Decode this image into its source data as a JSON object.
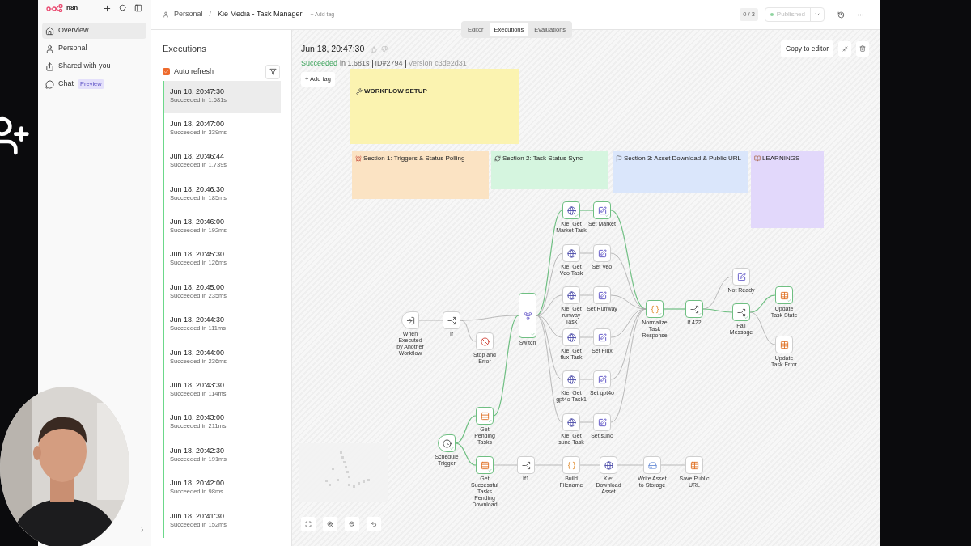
{
  "app": {
    "logo": "n8n"
  },
  "sidebar": {
    "items": [
      {
        "label": "Overview",
        "selected": true
      },
      {
        "label": "Personal",
        "selected": false
      },
      {
        "label": "Shared with you",
        "selected": false
      },
      {
        "label": "Chat",
        "badge": "Preview",
        "selected": false
      }
    ]
  },
  "breadcrumb": {
    "project": "Personal",
    "separator": "/",
    "workflow": "Kie Media - Task Manager",
    "add_tag": "+ Add tag"
  },
  "view_tabs": [
    {
      "label": "Editor",
      "selected": false
    },
    {
      "label": "Executions",
      "selected": true
    },
    {
      "label": "Evaluations",
      "selected": false
    }
  ],
  "header_right": {
    "counter": "0 / 3",
    "publish_status": "Published"
  },
  "executions": {
    "title": "Executions",
    "auto_refresh": {
      "label": "Auto refresh",
      "checked": true
    },
    "items": [
      {
        "time": "Jun 18, 20:47:30",
        "status": "Succeeded in 1.681s",
        "selected": true
      },
      {
        "time": "Jun 18, 20:47:00",
        "status": "Succeeded in 339ms",
        "selected": false
      },
      {
        "time": "Jun 18, 20:46:44",
        "status": "Succeeded in 1.739s",
        "selected": false
      },
      {
        "time": "Jun 18, 20:46:30",
        "status": "Succeeded in 185ms",
        "selected": false
      },
      {
        "time": "Jun 18, 20:46:00",
        "status": "Succeeded in 192ms",
        "selected": false
      },
      {
        "time": "Jun 18, 20:45:30",
        "status": "Succeeded in 126ms",
        "selected": false
      },
      {
        "time": "Jun 18, 20:45:00",
        "status": "Succeeded in 235ms",
        "selected": false
      },
      {
        "time": "Jun 18, 20:44:30",
        "status": "Succeeded in 111ms",
        "selected": false
      },
      {
        "time": "Jun 18, 20:44:00",
        "status": "Succeeded in 236ms",
        "selected": false
      },
      {
        "time": "Jun 18, 20:43:30",
        "status": "Succeeded in 114ms",
        "selected": false
      },
      {
        "time": "Jun 18, 20:43:00",
        "status": "Succeeded in 211ms",
        "selected": false
      },
      {
        "time": "Jun 18, 20:42:30",
        "status": "Succeeded in 191ms",
        "selected": false
      },
      {
        "time": "Jun 18, 20:42:00",
        "status": "Succeeded in 98ms",
        "selected": false
      },
      {
        "time": "Jun 18, 20:41:30",
        "status": "Succeeded in 152ms",
        "selected": false
      }
    ]
  },
  "execution_detail": {
    "time": "Jun 18, 20:47:30",
    "status": "Succeeded",
    "duration": "in 1.681s",
    "id": "ID#2794",
    "version": "Version c3de2d31",
    "add_tag": "+ Add tag",
    "copy_button": "Copy to editor"
  },
  "sticky_notes": [
    {
      "color": "#fbf3b0",
      "title": "WORKFLOW SETUP"
    },
    {
      "color": "#fbe3c3",
      "title": "Section 1: Triggers & Status Polling"
    },
    {
      "color": "#d5f5df",
      "title": "Section 2: Task Status Sync"
    },
    {
      "color": "#dae6fb",
      "title": "Section 3: Asset Download & Public URL"
    },
    {
      "color": "#e2d8fb",
      "title": "LEARNINGS"
    }
  ],
  "nodes": [
    {
      "label": "When Executed by Another Workflow",
      "kind": "trigger",
      "executed": false
    },
    {
      "label": "If",
      "kind": "if",
      "executed": false
    },
    {
      "label": "Stop and Error",
      "kind": "stop",
      "executed": false
    },
    {
      "label": "Switch",
      "kind": "switch",
      "executed": true
    },
    {
      "label": "Kie: Get Market Task",
      "kind": "http",
      "executed": true
    },
    {
      "label": "Set Market",
      "kind": "set",
      "executed": true
    },
    {
      "label": "Kie: Get Veo Task",
      "kind": "http",
      "executed": false
    },
    {
      "label": "Set Veo",
      "kind": "set",
      "executed": false
    },
    {
      "label": "Kie: Get runway Task",
      "kind": "http",
      "executed": false
    },
    {
      "label": "Set Runway",
      "kind": "set",
      "executed": false
    },
    {
      "label": "Kie: Get flux Task",
      "kind": "http",
      "executed": false
    },
    {
      "label": "Set Flux",
      "kind": "set",
      "executed": false
    },
    {
      "label": "Kie: Get gpt4o Task1",
      "kind": "http",
      "executed": false
    },
    {
      "label": "Set gpt4o",
      "kind": "set",
      "executed": false
    },
    {
      "label": "Kie: Get suno Task",
      "kind": "http",
      "executed": false
    },
    {
      "label": "Set suno",
      "kind": "set",
      "executed": false
    },
    {
      "label": "Normalize Task Response",
      "kind": "code",
      "executed": true
    },
    {
      "label": "If 422",
      "kind": "if",
      "executed": true
    },
    {
      "label": "Not Ready",
      "kind": "set",
      "executed": false
    },
    {
      "label": "Fail Message",
      "kind": "if",
      "executed": true
    },
    {
      "label": "Update Task State",
      "kind": "table",
      "executed": true
    },
    {
      "label": "Update Task Error",
      "kind": "table",
      "executed": false
    },
    {
      "label": "Get Pending Tasks",
      "kind": "table",
      "executed": true
    },
    {
      "label": "Schedule Trigger",
      "kind": "clock",
      "executed": true
    },
    {
      "label": "Get Successful Tasks Pending Download",
      "kind": "table",
      "executed": true
    },
    {
      "label": "If1",
      "kind": "if",
      "executed": false
    },
    {
      "label": "Build Filename",
      "kind": "code",
      "executed": false
    },
    {
      "label": "Kie: Download Asset",
      "kind": "http",
      "executed": false
    },
    {
      "label": "Write Asset to Storage",
      "kind": "storage",
      "executed": false
    },
    {
      "label": "Save Public URL",
      "kind": "table",
      "executed": false
    }
  ]
}
